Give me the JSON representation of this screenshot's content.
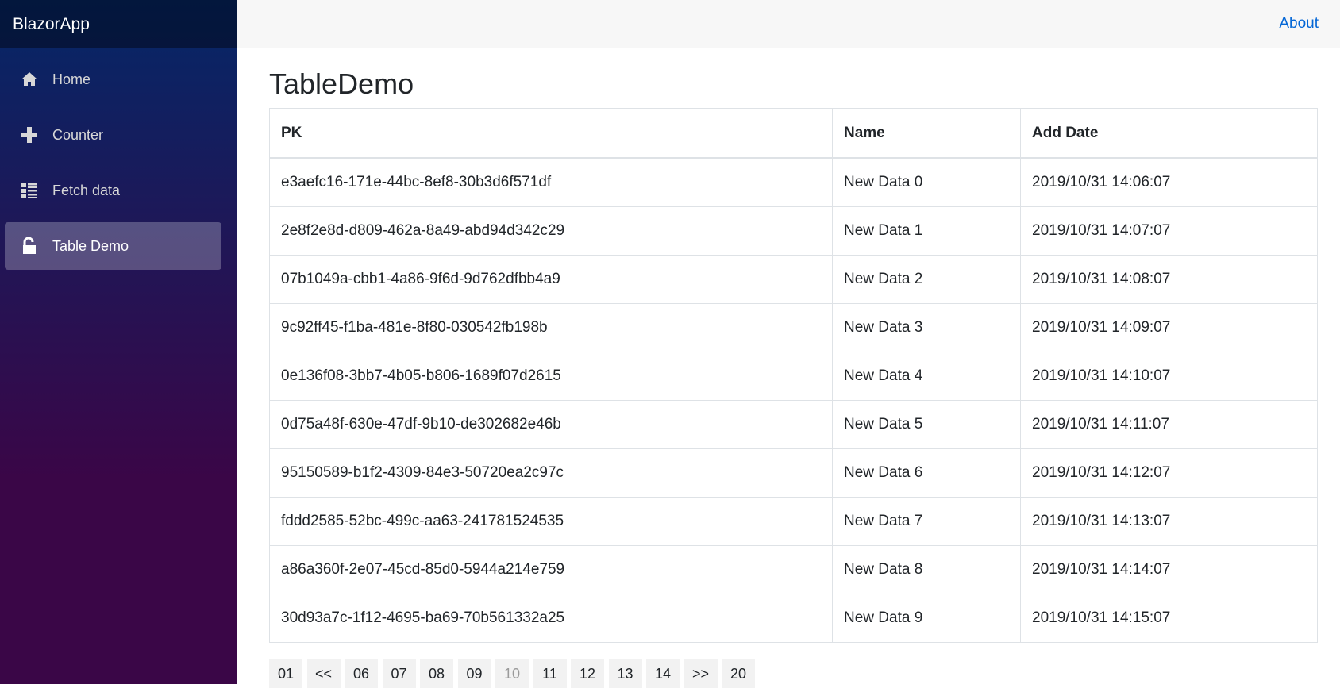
{
  "brand": "BlazorApp",
  "header": {
    "about_label": "About"
  },
  "nav": {
    "items": [
      {
        "label": "Home",
        "icon": "home-icon"
      },
      {
        "label": "Counter",
        "icon": "plus-icon"
      },
      {
        "label": "Fetch data",
        "icon": "list-icon"
      },
      {
        "label": "Table Demo",
        "icon": "unlock-icon"
      }
    ],
    "active": "Table Demo"
  },
  "page_title": "TableDemo",
  "table": {
    "columns": [
      "PK",
      "Name",
      "Add Date"
    ],
    "rows": [
      [
        "e3aefc16-171e-44bc-8ef8-30b3d6f571df",
        "New Data 0",
        "2019/10/31 14:06:07"
      ],
      [
        "2e8f2e8d-d809-462a-8a49-abd94d342c29",
        "New Data 1",
        "2019/10/31 14:07:07"
      ],
      [
        "07b1049a-cbb1-4a86-9f6d-9d762dfbb4a9",
        "New Data 2",
        "2019/10/31 14:08:07"
      ],
      [
        "9c92ff45-f1ba-481e-8f80-030542fb198b",
        "New Data 3",
        "2019/10/31 14:09:07"
      ],
      [
        "0e136f08-3bb7-4b05-b806-1689f07d2615",
        "New Data 4",
        "2019/10/31 14:10:07"
      ],
      [
        "0d75a48f-630e-47df-9b10-de302682e46b",
        "New Data 5",
        "2019/10/31 14:11:07"
      ],
      [
        "95150589-b1f2-4309-84e3-50720ea2c97c",
        "New Data 6",
        "2019/10/31 14:12:07"
      ],
      [
        "fddd2585-52bc-499c-aa63-241781524535",
        "New Data 7",
        "2019/10/31 14:13:07"
      ],
      [
        "a86a360f-2e07-45cd-85d0-5944a214e759",
        "New Data 8",
        "2019/10/31 14:14:07"
      ],
      [
        "30d93a7c-1f12-4695-ba69-70b561332a25",
        "New Data 9",
        "2019/10/31 14:15:07"
      ]
    ]
  },
  "pager": {
    "buttons": [
      "01",
      "<<",
      "06",
      "07",
      "08",
      "09",
      "10",
      "11",
      "12",
      "13",
      "14",
      ">>",
      "20"
    ],
    "current": "10"
  },
  "colors": {
    "sidebar_top": "#052767",
    "sidebar_bottom": "#3a0647",
    "link": "#0366d6",
    "header_bg": "#f7f7f7"
  }
}
